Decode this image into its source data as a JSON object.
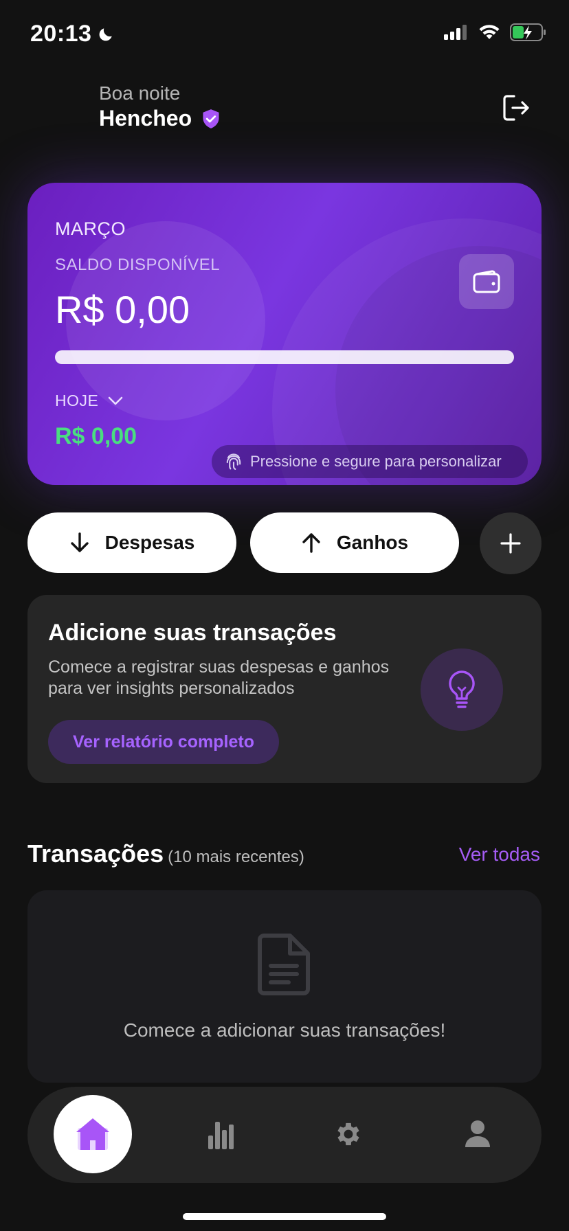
{
  "status_bar": {
    "time": "20:13",
    "battery_color": "#34c759"
  },
  "header": {
    "greeting": "Boa noite",
    "user_name": "Hencheo"
  },
  "balance_card": {
    "month": "MARÇO",
    "available_label": "SALDO DISPONÍVEL",
    "available_value": "R$ 0,00",
    "progress_fraction": 1.0,
    "period_label": "HOJE",
    "period_value": "R$ 0,00",
    "customize_hint": "Pressione e segure para personalizar"
  },
  "actions": {
    "expenses_label": "Despesas",
    "income_label": "Ganhos"
  },
  "insight": {
    "title": "Adicione suas transações",
    "description": "Comece a registrar suas despesas e ganhos para ver insights personalizados",
    "button_label": "Ver relatório completo"
  },
  "transactions": {
    "title": "Transações",
    "subtitle": "(10 mais recentes)",
    "see_all_label": "Ver todas",
    "empty_message": "Comece a adicionar suas transações!"
  },
  "bottom_nav": {
    "items": [
      {
        "icon": "home-icon",
        "active": true
      },
      {
        "icon": "bar-chart-icon",
        "active": false
      },
      {
        "icon": "gear-icon",
        "active": false
      },
      {
        "icon": "person-icon",
        "active": false
      }
    ]
  },
  "colors": {
    "accent": "#a55cf5",
    "income_green": "#4ade80",
    "background": "#121212"
  }
}
